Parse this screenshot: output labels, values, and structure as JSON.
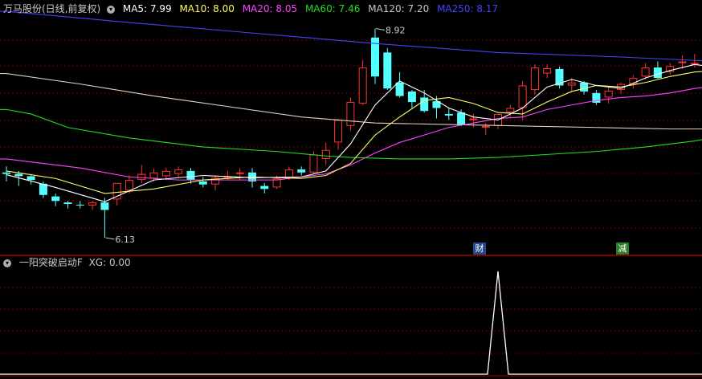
{
  "header": {
    "title": "万马股份(日线,前复权)",
    "ma": [
      {
        "label": "MA5: 7.99",
        "color": "#ffffff"
      },
      {
        "label": "MA10: 8.00",
        "color": "#ffff66"
      },
      {
        "label": "MA20: 8.05",
        "color": "#ff44ff"
      },
      {
        "label": "MA60: 7.46",
        "color": "#22dd22"
      },
      {
        "label": "MA120: 7.20",
        "color": "#c8c8c8"
      },
      {
        "label": "MA250: 8.17",
        "color": "#4444ff"
      }
    ]
  },
  "indicator": {
    "title": "一阳突破启动F",
    "xg": "XG: 0.00"
  },
  "badges": {
    "cai": "财",
    "jian": "减"
  },
  "colors": {
    "up": "#ff3232",
    "down": "#54ffff",
    "grid": "#7a0000",
    "ma5": "#ffffff",
    "ma10": "#ffff66",
    "ma20": "#ff44ff",
    "ma60": "#22dd22",
    "ma120": "#d8d8c0",
    "ma250": "#4444ff"
  },
  "chart_data": {
    "type": "candlestick",
    "annotations": [
      {
        "text": "8.92",
        "kind": "high",
        "index": 30
      },
      {
        "text": "6.13",
        "kind": "low",
        "index": 8
      }
    ],
    "candles": [
      [
        7.0,
        7.08,
        6.88,
        6.98
      ],
      [
        6.98,
        7.02,
        6.82,
        6.95
      ],
      [
        6.95,
        6.98,
        6.84,
        6.9
      ],
      [
        6.85,
        6.88,
        6.66,
        6.7
      ],
      [
        6.68,
        6.72,
        6.55,
        6.62
      ],
      [
        6.6,
        6.62,
        6.52,
        6.58
      ],
      [
        6.57,
        6.62,
        6.52,
        6.56
      ],
      [
        6.56,
        6.62,
        6.5,
        6.6
      ],
      [
        6.6,
        6.66,
        6.13,
        6.5
      ],
      [
        6.64,
        6.86,
        6.56,
        6.86
      ],
      [
        6.76,
        6.96,
        6.72,
        6.9
      ],
      [
        6.9,
        7.1,
        6.86,
        6.98
      ],
      [
        6.92,
        7.05,
        6.88,
        7.0
      ],
      [
        6.95,
        7.06,
        6.9,
        7.02
      ],
      [
        6.98,
        7.08,
        6.94,
        7.04
      ],
      [
        7.02,
        7.06,
        6.85,
        6.9
      ],
      [
        6.88,
        6.94,
        6.8,
        6.84
      ],
      [
        6.84,
        6.96,
        6.76,
        6.93
      ],
      [
        6.93,
        7.02,
        6.9,
        6.95
      ],
      [
        6.98,
        7.06,
        6.9,
        7.0
      ],
      [
        7.0,
        7.06,
        6.8,
        6.88
      ],
      [
        6.82,
        6.86,
        6.72,
        6.78
      ],
      [
        6.8,
        6.96,
        6.78,
        6.92
      ],
      [
        6.92,
        7.08,
        6.9,
        7.04
      ],
      [
        7.04,
        7.08,
        6.96,
        7.0
      ],
      [
        7.0,
        7.28,
        6.98,
        7.24
      ],
      [
        7.18,
        7.4,
        7.1,
        7.3
      ],
      [
        7.4,
        7.72,
        7.3,
        7.7
      ],
      [
        7.62,
        8.0,
        7.56,
        7.94
      ],
      [
        7.92,
        8.5,
        7.9,
        8.4
      ],
      [
        8.8,
        8.92,
        8.18,
        8.28
      ],
      [
        8.6,
        8.66,
        8.1,
        8.12
      ],
      [
        8.2,
        8.34,
        8.0,
        8.02
      ],
      [
        8.08,
        8.1,
        7.86,
        7.94
      ],
      [
        8.0,
        8.1,
        7.8,
        7.82
      ],
      [
        7.95,
        8.02,
        7.72,
        7.86
      ],
      [
        7.78,
        7.86,
        7.7,
        7.76
      ],
      [
        7.8,
        7.84,
        7.62,
        7.64
      ],
      [
        7.7,
        7.78,
        7.6,
        7.72
      ],
      [
        7.62,
        7.66,
        7.5,
        7.62
      ],
      [
        7.62,
        7.78,
        7.58,
        7.78
      ],
      [
        7.8,
        7.9,
        7.74,
        7.86
      ],
      [
        7.86,
        8.22,
        7.7,
        8.16
      ],
      [
        8.1,
        8.44,
        8.04,
        8.4
      ],
      [
        8.32,
        8.44,
        8.26,
        8.39
      ],
      [
        8.38,
        8.41,
        8.12,
        8.16
      ],
      [
        8.16,
        8.26,
        8.08,
        8.2
      ],
      [
        8.2,
        8.22,
        8.04,
        8.08
      ],
      [
        8.06,
        8.1,
        7.9,
        7.93
      ],
      [
        8.0,
        8.14,
        7.92,
        8.09
      ],
      [
        8.1,
        8.2,
        8.05,
        8.18
      ],
      [
        8.18,
        8.3,
        8.12,
        8.26
      ],
      [
        8.28,
        8.46,
        8.24,
        8.4
      ],
      [
        8.4,
        8.48,
        8.25,
        8.26
      ],
      [
        8.34,
        8.46,
        8.3,
        8.42
      ],
      [
        8.48,
        8.56,
        8.38,
        8.48
      ],
      [
        8.44,
        8.58,
        8.4,
        8.46
      ],
      [
        8.4,
        8.48,
        8.26,
        8.3
      ],
      [
        8.3,
        8.4,
        8.2,
        8.35
      ]
    ],
    "ma": {
      "ma5": [
        [
          0,
          6.97
        ],
        [
          4,
          6.8
        ],
        [
          8,
          6.61
        ],
        [
          12,
          6.9
        ],
        [
          16,
          6.96
        ],
        [
          20,
          6.93
        ],
        [
          24,
          6.94
        ],
        [
          26,
          7.02
        ],
        [
          28,
          7.38
        ],
        [
          30,
          7.9
        ],
        [
          32,
          8.22
        ],
        [
          34,
          8.06
        ],
        [
          36,
          7.86
        ],
        [
          38,
          7.74
        ],
        [
          40,
          7.7
        ],
        [
          42,
          7.86
        ],
        [
          44,
          8.14
        ],
        [
          46,
          8.24
        ],
        [
          48,
          8.16
        ],
        [
          50,
          8.12
        ],
        [
          52,
          8.26
        ],
        [
          54,
          8.36
        ],
        [
          56,
          8.44
        ],
        [
          58,
          8.4
        ]
      ],
      "ma10": [
        [
          0,
          7.02
        ],
        [
          4,
          6.92
        ],
        [
          8,
          6.72
        ],
        [
          12,
          6.78
        ],
        [
          16,
          6.9
        ],
        [
          20,
          6.94
        ],
        [
          24,
          6.92
        ],
        [
          26,
          6.96
        ],
        [
          28,
          7.12
        ],
        [
          30,
          7.5
        ],
        [
          32,
          7.74
        ],
        [
          34,
          7.96
        ],
        [
          36,
          8.0
        ],
        [
          38,
          7.92
        ],
        [
          40,
          7.8
        ],
        [
          42,
          7.78
        ],
        [
          44,
          7.94
        ],
        [
          46,
          8.08
        ],
        [
          48,
          8.16
        ],
        [
          50,
          8.14
        ],
        [
          52,
          8.2
        ],
        [
          54,
          8.28
        ],
        [
          56,
          8.34
        ],
        [
          58,
          8.36
        ]
      ],
      "ma20": [
        [
          0,
          7.18
        ],
        [
          6,
          7.06
        ],
        [
          10,
          6.94
        ],
        [
          14,
          6.9
        ],
        [
          18,
          6.9
        ],
        [
          22,
          6.9
        ],
        [
          26,
          6.98
        ],
        [
          28,
          7.1
        ],
        [
          30,
          7.26
        ],
        [
          32,
          7.4
        ],
        [
          34,
          7.5
        ],
        [
          36,
          7.6
        ],
        [
          38,
          7.66
        ],
        [
          40,
          7.72
        ],
        [
          42,
          7.74
        ],
        [
          44,
          7.84
        ],
        [
          46,
          7.9
        ],
        [
          48,
          7.96
        ],
        [
          50,
          8.0
        ],
        [
          52,
          8.02
        ],
        [
          54,
          8.06
        ],
        [
          56,
          8.12
        ],
        [
          58,
          8.16
        ]
      ],
      "ma60": [
        [
          0,
          7.84
        ],
        [
          2,
          7.78
        ],
        [
          5,
          7.6
        ],
        [
          10,
          7.46
        ],
        [
          16,
          7.34
        ],
        [
          22,
          7.28
        ],
        [
          26,
          7.22
        ],
        [
          28,
          7.2
        ],
        [
          32,
          7.18
        ],
        [
          36,
          7.18
        ],
        [
          40,
          7.2
        ],
        [
          44,
          7.24
        ],
        [
          48,
          7.28
        ],
        [
          52,
          7.34
        ],
        [
          56,
          7.42
        ],
        [
          58,
          7.48
        ]
      ],
      "ma120": [
        [
          0,
          8.32
        ],
        [
          6,
          8.18
        ],
        [
          12,
          8.02
        ],
        [
          18,
          7.88
        ],
        [
          24,
          7.74
        ],
        [
          30,
          7.66
        ],
        [
          36,
          7.64
        ],
        [
          42,
          7.62
        ],
        [
          48,
          7.6
        ],
        [
          54,
          7.58
        ],
        [
          58,
          7.58
        ]
      ],
      "ma250": [
        [
          0,
          9.15
        ],
        [
          10,
          9.0
        ],
        [
          20,
          8.86
        ],
        [
          30,
          8.72
        ],
        [
          40,
          8.6
        ],
        [
          50,
          8.54
        ],
        [
          58,
          8.48
        ]
      ]
    },
    "xg": {
      "peak_index": 40,
      "value_at_peak": 1,
      "latest": 0.0
    }
  }
}
